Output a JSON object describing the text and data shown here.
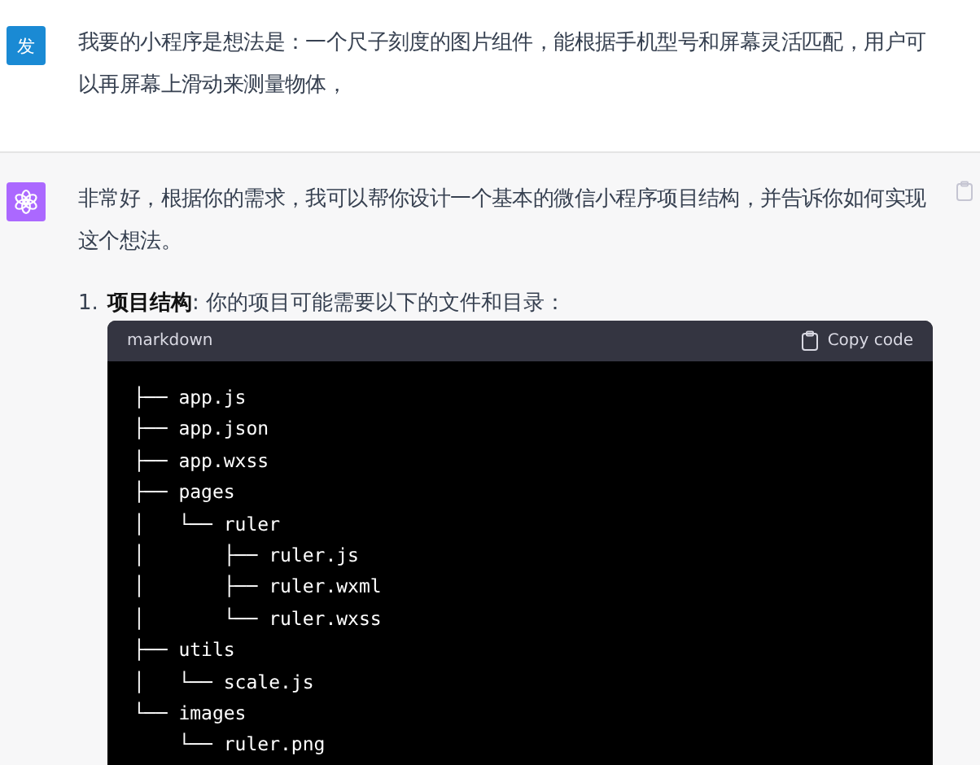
{
  "messages": [
    {
      "kind": "user",
      "avatar": "发",
      "text": "我要的小程序是想法是：一个尺子刻度的图片组件，能根据手机型号和屏幕灵活匹配，用户可以再屏幕上滑动来测量物体，"
    },
    {
      "kind": "assistant",
      "text": "非常好，根据你的需求，我可以帮你设计一个基本的微信小程序项目结构，并告诉你如何实现这个想法。",
      "list": [
        {
          "number": "1.",
          "text": "**项目结构**: 你的项目可能需要以下的文件和目录：",
          "code": {
            "language": "markdown",
            "copy_label": "Copy code",
            "lines": [
              "├── app.js",
              "├── app.json",
              "├── app.wxss",
              "├── pages",
              "│   └── ruler",
              "│       ├── ruler.js",
              "│       ├── ruler.wxml",
              "│       └── ruler.wxss",
              "├── utils",
              "│   └── scale.js",
              "└── images",
              "    └── ruler.png"
            ]
          }
        }
      ]
    }
  ]
}
